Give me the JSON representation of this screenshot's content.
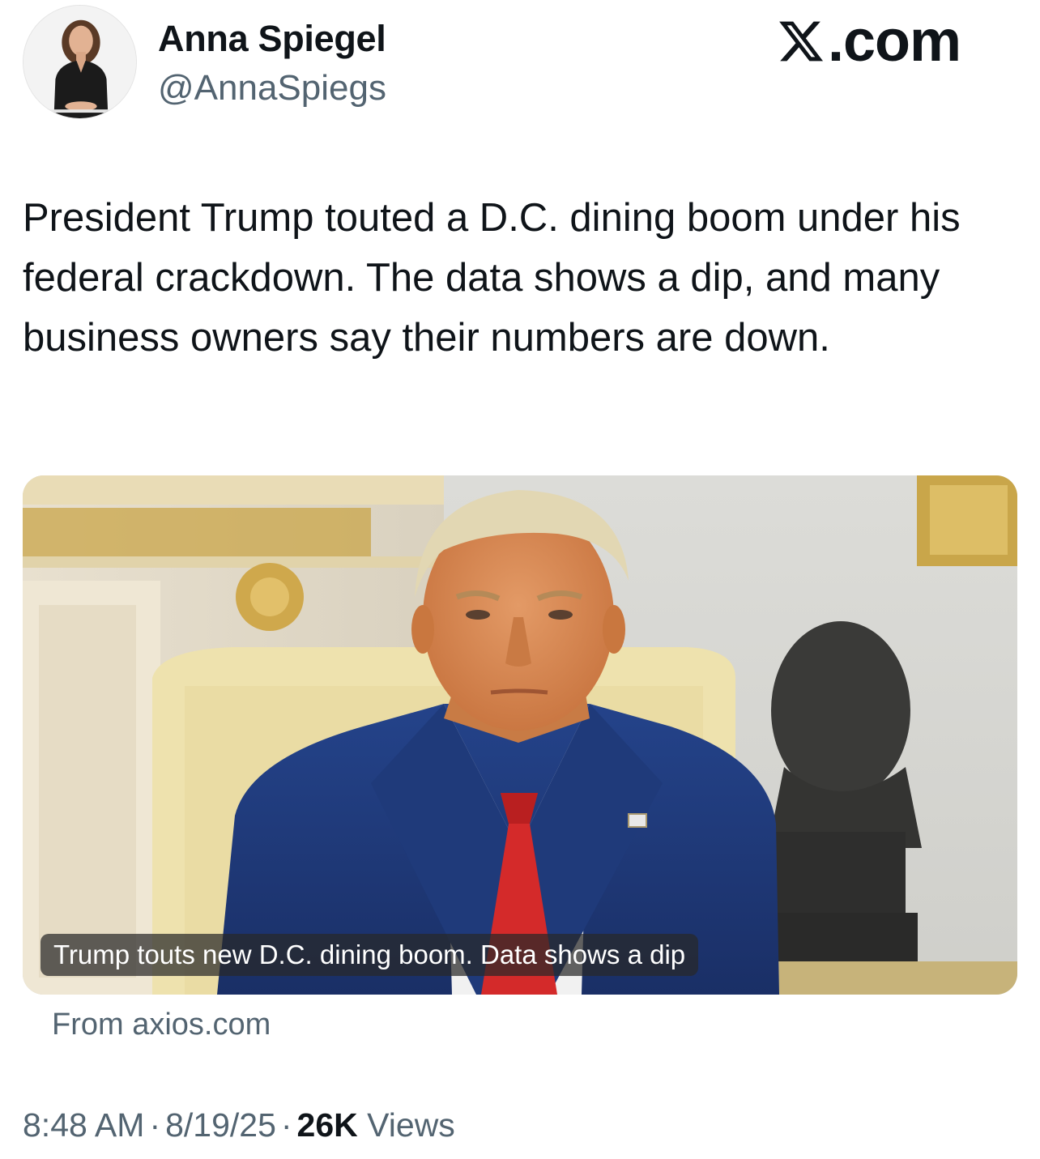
{
  "author": {
    "name": "Anna Spiegel",
    "handle": "@AnnaSpiegs"
  },
  "brand": {
    "label": ".com",
    "icon": "x-logo-icon"
  },
  "tweet": {
    "text": "President Trump touted a D.C. dining boom under his federal crackdown. The data shows a dip, and many business owners say their numbers are down."
  },
  "card": {
    "caption": "Trump touts new D.C. dining boom. Data shows a dip",
    "source": "From axios.com"
  },
  "meta": {
    "time": "8:48 AM",
    "separator": "·",
    "date": "8/19/25",
    "views_count": "26K",
    "views_label": "Views"
  },
  "colors": {
    "text_primary": "#0f1419",
    "text_secondary": "#536471",
    "tie": "#d42a2a",
    "suit": "#1f3a78"
  }
}
